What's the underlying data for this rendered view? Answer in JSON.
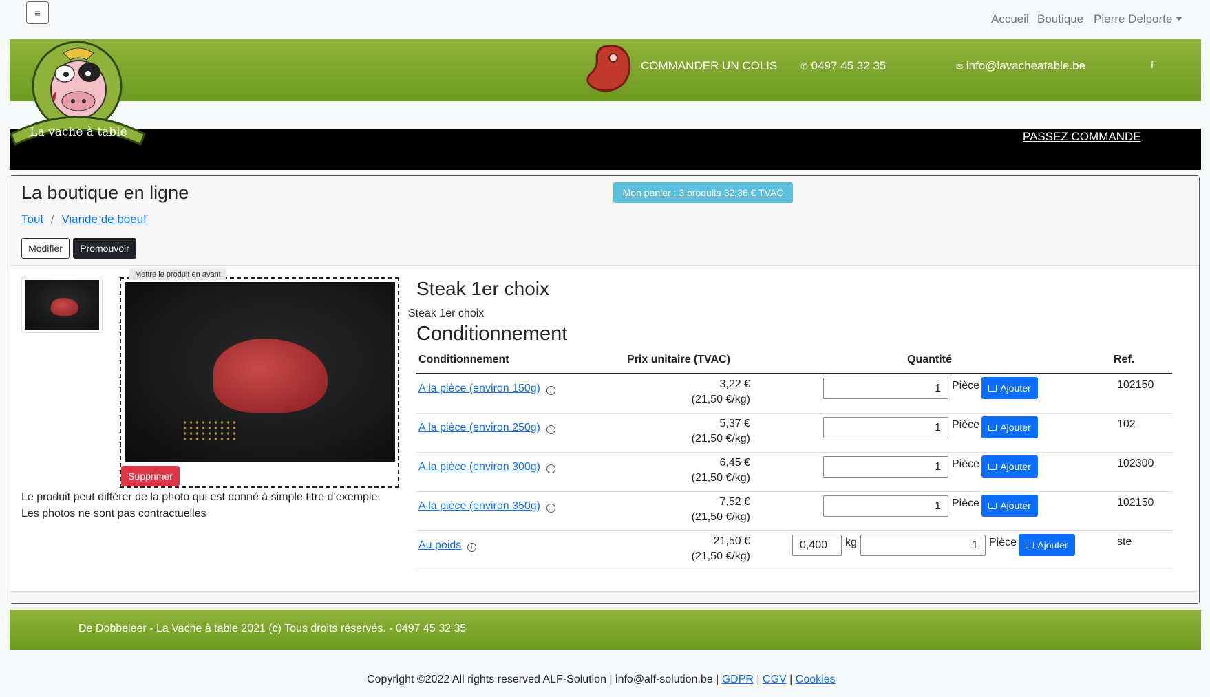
{
  "nav": {
    "menu_icon": "≡",
    "items": [
      "Accueil",
      "Boutique"
    ],
    "user": "Pierre Delporte"
  },
  "header": {
    "logo_text": "La vache à table",
    "order_label": "COMMANDER UN COLIS",
    "phone": "0497 45 32 35",
    "email": "info@lavacheatable.be",
    "facebook": "f",
    "passez": "PASSEZ COMMANDE"
  },
  "shop": {
    "title": "La boutique en ligne",
    "cart_label": "Mon panier : 3 produits 32,36 € TVAC",
    "breadcrumb": [
      "Tout",
      "Viande de boeuf"
    ],
    "modifier": "Modifier",
    "promouvoir": "Promouvoir"
  },
  "images": {
    "feature_label": "Mettre le produit en avant",
    "delete_label": "Supprimer",
    "disclaimer_1": "Le produit peut différer de la photo qui est donné à simple titre d’exemple.",
    "disclaimer_2": "Les photos ne sont pas contractuelles"
  },
  "product": {
    "name": "Steak 1er choix",
    "subtitle": "Steak 1er choix",
    "section": "Conditionnement",
    "columns": [
      "Conditionnement",
      "Prix unitaire (TVAC)",
      "Quantité",
      "Ref."
    ],
    "rows": [
      {
        "label": "A la pièce (environ 150g)",
        "price": "3,22 €",
        "per_kg": "(21,50 €/kg)",
        "qty": "1",
        "unit": "Pièce",
        "add": "Ajouter",
        "ref": "102150"
      },
      {
        "label": "A la pièce (environ 250g)",
        "price": "5,37 €",
        "per_kg": "(21,50 €/kg)",
        "qty": "1",
        "unit": "Pièce",
        "add": "Ajouter",
        "ref": "102"
      },
      {
        "label": "A la pièce (environ 300g)",
        "price": "6,45 €",
        "per_kg": "(21,50 €/kg)",
        "qty": "1",
        "unit": "Pièce",
        "add": "Ajouter",
        "ref": "102300"
      },
      {
        "label": "A la pièce (environ 350g)",
        "price": "7,52 €",
        "per_kg": "(21,50 €/kg)",
        "qty": "1",
        "unit": "Pièce",
        "add": "Ajouter",
        "ref": "102150"
      },
      {
        "label": "Au poids",
        "price": "21,50 €",
        "per_kg": "(21,50 €/kg)",
        "weight": "0,400",
        "weight_unit": "kg",
        "qty": "1",
        "unit": "Pièce",
        "add": "Ajouter",
        "ref": "ste"
      }
    ]
  },
  "footer": {
    "text": "De Dobbeleer - La Vache à table 2021 (c) Tous droits réservés. - 0497 45 32 35",
    "copyright": "Copyright ©2022 All rights reserved ALF-Solution | info@alf-solution.be |",
    "links": [
      "GDPR",
      "CGV",
      "Cookies"
    ]
  },
  "colors": {
    "green": "#7aa62c",
    "primary": "#0d6efd",
    "danger": "#dc3545",
    "cart": "#5bc0de"
  }
}
